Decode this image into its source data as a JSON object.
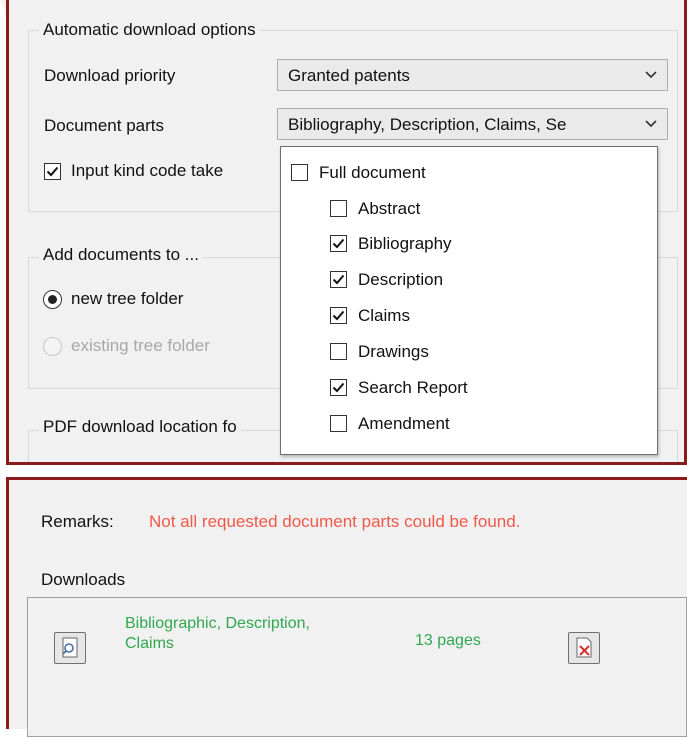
{
  "auto": {
    "group_title": "Automatic download options",
    "priority_label": "Download priority",
    "priority_value": "Granted patents",
    "parts_label": "Document parts",
    "parts_value": "Bibliography, Description, Claims, Se",
    "kind_code_label": "Input kind code take",
    "kind_code_checked": true
  },
  "add_docs": {
    "group_title": "Add documents to ...",
    "new_folder_label": "new tree folder",
    "existing_folder_label": "existing tree folder",
    "selected": "new tree folder"
  },
  "pdf": {
    "group_title": "PDF download location fo"
  },
  "dropdown": {
    "items": [
      {
        "label": "Full document",
        "checked": false
      },
      {
        "label": "Abstract",
        "checked": false
      },
      {
        "label": "Bibliography",
        "checked": true
      },
      {
        "label": "Description",
        "checked": true
      },
      {
        "label": "Claims",
        "checked": true
      },
      {
        "label": "Drawings",
        "checked": false
      },
      {
        "label": "Search Report",
        "checked": true
      },
      {
        "label": "Amendment",
        "checked": false
      }
    ]
  },
  "remarks": {
    "label": "Remarks:",
    "message": "Not all requested document parts could be found.",
    "message_color": "#f0584a"
  },
  "downloads": {
    "label": "Downloads",
    "item": {
      "name_line1": "Bibliographic, Description,",
      "name_line2": "Claims",
      "pages": "13 pages",
      "color": "#2fa84f"
    }
  }
}
